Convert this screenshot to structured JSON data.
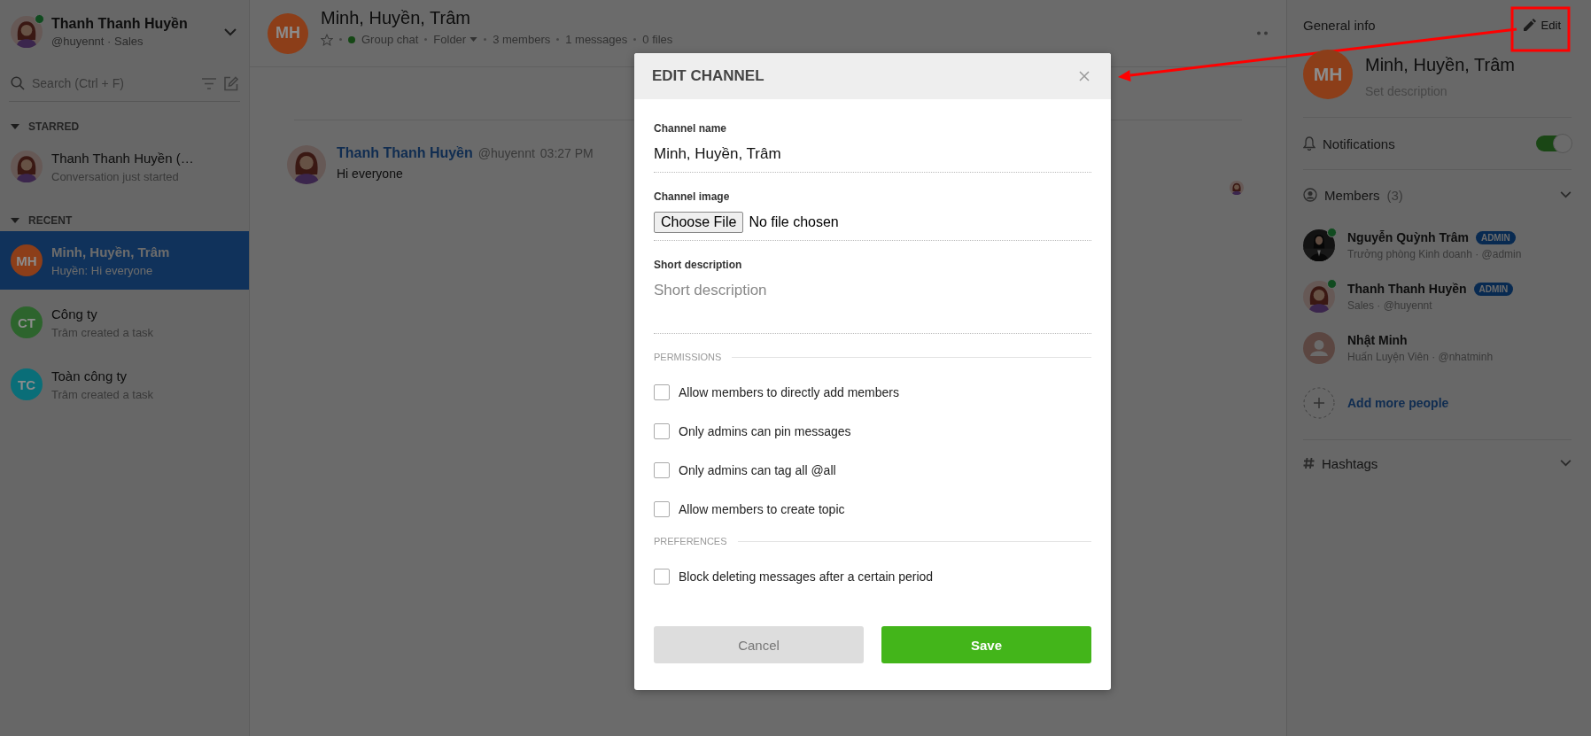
{
  "sidebar": {
    "user": {
      "name": "Thanh Thanh Huyền",
      "subtitle": "@huyennt · Sales",
      "online": true
    },
    "search": {
      "placeholder": "Search (Ctrl + F)"
    },
    "sections": [
      {
        "title": "STARRED",
        "expanded": true,
        "items": [
          {
            "title": "Thanh Thanh Huyền (…",
            "subtitle": "Conversation just started",
            "avatar": {
              "kind": "person"
            },
            "selected": false
          }
        ]
      },
      {
        "title": "RECENT",
        "expanded": true,
        "items": [
          {
            "title": "Minh, Huyền, Trâm",
            "subtitle": "Huyền: Hi everyone",
            "avatar": {
              "kind": "initials",
              "initials": "MH",
              "color": "#8c3e19"
            },
            "selected": true
          },
          {
            "title": "Công ty",
            "subtitle": "Trâm created a task",
            "avatar": {
              "kind": "initials",
              "initials": "CT",
              "color": "#2d642d"
            },
            "selected": false
          },
          {
            "title": "Toàn công ty",
            "subtitle": "Trâm created a task",
            "avatar": {
              "kind": "initials",
              "initials": "TC",
              "color": "#0a6e78"
            },
            "selected": false
          }
        ]
      }
    ]
  },
  "channel_header": {
    "initials": "MH",
    "color": "#8c3e19",
    "title": "Minh, Huyền, Trâm",
    "starred": false,
    "active": true,
    "type": "Group chat",
    "folder": "Folder",
    "members": "3 members",
    "messages": "1 messages",
    "files": "0 files"
  },
  "messages": [
    {
      "author": "Thanh Thanh Huyền",
      "handle": "@huyennt",
      "time": "03:27 PM",
      "text": "Hi everyone"
    }
  ],
  "info_panel": {
    "title": "General info",
    "edit_button": "Edit",
    "channel": {
      "initials": "MH",
      "color": "#8c3e19",
      "name": "Minh, Huyền, Trâm",
      "description_placeholder": "Set description"
    },
    "notifications": {
      "label": "Notifications",
      "on": true
    },
    "members": {
      "label": "Members",
      "count": "(3)",
      "items": [
        {
          "name": "Nguyễn Quỳnh Trâm",
          "badge": "ADMIN",
          "subtitle": "Trưởng phòng Kinh doanh · @admin",
          "online": true
        },
        {
          "name": "Thanh Thanh Huyền",
          "badge": "ADMIN",
          "subtitle": "Sales · @huyennt",
          "online": true,
          "avatar": {
            "kind": "person"
          }
        },
        {
          "name": "Nhật Minh",
          "subtitle": "Huấn Luyện Viên · @nhatminh",
          "online": false,
          "avatar": {
            "kind": "placeholder"
          }
        }
      ],
      "add_label": "Add more people"
    },
    "hashtags": {
      "label": "Hashtags"
    }
  },
  "modal": {
    "title": "EDIT CHANNEL",
    "fields": [
      {
        "kind": "text",
        "label": "Channel name",
        "value": "Minh, Huyền, Trâm"
      },
      {
        "kind": "file",
        "label": "Channel image",
        "button": "Choose File",
        "status": "No file chosen"
      },
      {
        "kind": "textarea",
        "label": "Short description",
        "placeholder": "Short description"
      }
    ],
    "sections": [
      {
        "title": "PERMISSIONS",
        "options": [
          {
            "label": "Allow members to directly add members",
            "checked": false
          },
          {
            "label": "Only admins can pin messages",
            "checked": false
          },
          {
            "label": "Only admins can tag all @all",
            "checked": false
          },
          {
            "label": "Allow members to create topic",
            "checked": false
          }
        ]
      },
      {
        "title": "PREFERENCES",
        "options": [
          {
            "label": "Block deleting messages after a certain period",
            "checked": false
          }
        ]
      }
    ],
    "buttons": [
      {
        "label": "Cancel",
        "kind": "secondary"
      },
      {
        "label": "Save",
        "kind": "primary"
      }
    ]
  }
}
